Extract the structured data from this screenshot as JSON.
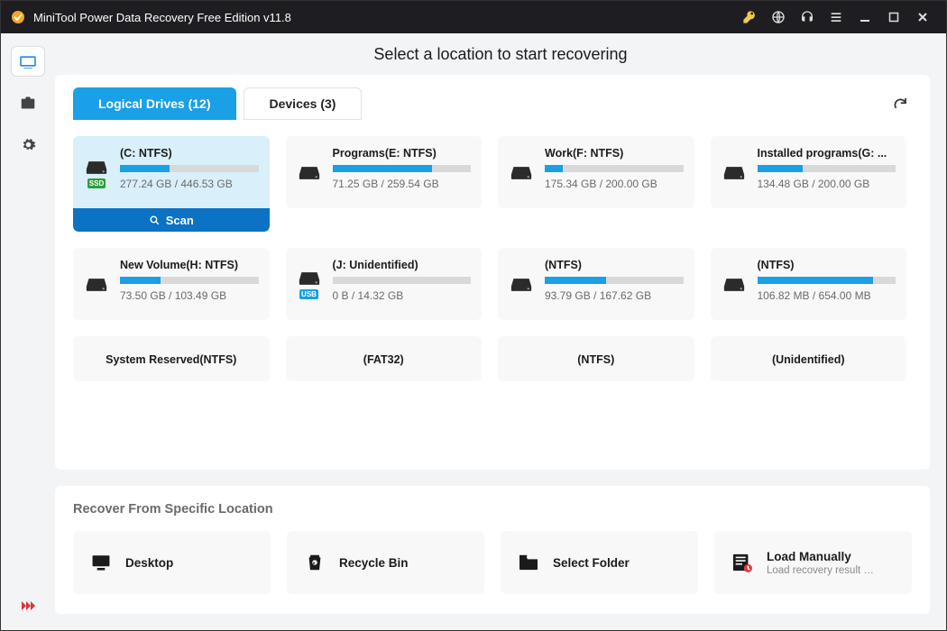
{
  "titlebar": {
    "title": "MiniTool Power Data Recovery Free Edition v11.8"
  },
  "heading": "Select a location to start recovering",
  "tabs": {
    "logical": "Logical Drives (12)",
    "devices": "Devices (3)"
  },
  "scan_label": "Scan",
  "drives": [
    {
      "name": "(C: NTFS)",
      "size": "277.24 GB / 446.53 GB",
      "pct": 36,
      "badge": "SSD",
      "selected": true
    },
    {
      "name": "Programs(E: NTFS)",
      "size": "71.25 GB / 259.54 GB",
      "pct": 72,
      "badge": ""
    },
    {
      "name": "Work(F: NTFS)",
      "size": "175.34 GB / 200.00 GB",
      "pct": 13,
      "badge": ""
    },
    {
      "name": "Installed programs(G: ...",
      "size": "134.48 GB / 200.00 GB",
      "pct": 33,
      "badge": ""
    },
    {
      "name": "New Volume(H: NTFS)",
      "size": "73.50 GB / 103.49 GB",
      "pct": 29,
      "badge": ""
    },
    {
      "name": "(J: Unidentified)",
      "size": "0 B / 14.32 GB",
      "pct": 0,
      "badge": "USB"
    },
    {
      "name": "(NTFS)",
      "size": "93.79 GB / 167.62 GB",
      "pct": 44,
      "badge": ""
    },
    {
      "name": "(NTFS)",
      "size": "106.82 MB / 654.00 MB",
      "pct": 84,
      "badge": ""
    }
  ],
  "drives_partial": [
    {
      "name": "System Reserved(NTFS)"
    },
    {
      "name": "(FAT32)"
    },
    {
      "name": "(NTFS)"
    },
    {
      "name": "(Unidentified)"
    }
  ],
  "recover": {
    "title": "Recover From Specific Location",
    "items": [
      {
        "label": "Desktop",
        "sub": ""
      },
      {
        "label": "Recycle Bin",
        "sub": ""
      },
      {
        "label": "Select Folder",
        "sub": ""
      },
      {
        "label": "Load Manually",
        "sub": "Load recovery result (*..."
      }
    ]
  }
}
